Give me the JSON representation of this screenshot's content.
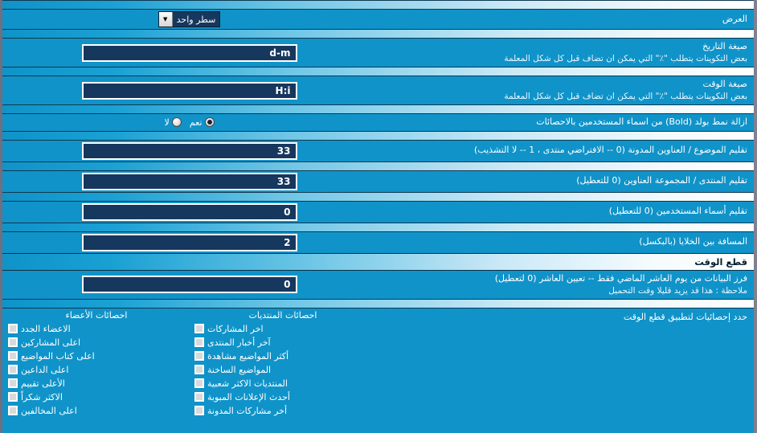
{
  "display_row": {
    "label": "العرض",
    "select_value": "سطر واحد",
    "options": [
      "سطر واحد"
    ]
  },
  "date_format_row": {
    "label": "صيغة التاريخ",
    "sub": "بعض التكوينات يتطلب \"٪\" التي يمكن ان تضاف قبل كل شكل المعلمة",
    "value": "d-m"
  },
  "time_format_row": {
    "label": "صيغة الوقت",
    "sub": "بعض التكوينات يتطلب \"٪\" التي يمكن ان تضاف قبل كل شكل المعلمة",
    "value": "H:i"
  },
  "bold_row": {
    "label": "ازالة نمط بولد (Bold) من اسماء المستخدمين بالاحصائات",
    "yes_label": "نعم",
    "no_label": "لا",
    "selected": "yes"
  },
  "topic_trim_row": {
    "label": "تقليم الموضوع / العناوين المدونة (0 -- الافتراضي منتدى ، 1 -- لا التشذيب)",
    "value": "33"
  },
  "forum_trim_row": {
    "label": "تقليم المنتدى / المجموعة العناوين (0 للتعطيل)",
    "value": "33"
  },
  "username_trim_row": {
    "label": "تقليم أسماء المستخدمين (0 للتعطيل)",
    "value": "0"
  },
  "cell_spacing_row": {
    "label": "المسافة بين الخلايا (بالبكسل)",
    "value": "2"
  },
  "cutoff_section": {
    "title": "قطع الوقت"
  },
  "cutoff_days_row": {
    "label": "فرز البيانات من يوم العاشر الماضي فقط -- تعيين العاشر (0 لتعطيل)",
    "sub": "ملاحظة : هذا قد يزيد قليلا وقت التحميل",
    "value": "0"
  },
  "cutoff_stats_row": {
    "label": "حدد إحصائيات لتطبيق قطع الوقت",
    "columns": [
      {
        "header": "احصائات المنتديات",
        "items": [
          {
            "label": "اخر المشاركات",
            "checked": false
          },
          {
            "label": "آخر أخبار المنتدى",
            "checked": false
          },
          {
            "label": "أكثر المواضيع مشاهدة",
            "checked": false
          },
          {
            "label": "المواضيع الساخنة",
            "checked": false
          },
          {
            "label": "المنتديات الاكثر شعبية",
            "checked": false
          },
          {
            "label": "أحدث الإعلانات المبوبة",
            "checked": false
          },
          {
            "label": "أخر مشاركات المدونة",
            "checked": false
          }
        ]
      },
      {
        "header": "احصائات الأعضاء",
        "items": [
          {
            "label": "الاعضاء الجدد",
            "checked": false
          },
          {
            "label": "اعلى المشاركين",
            "checked": false
          },
          {
            "label": "اعلى كتاب المواضيع",
            "checked": false
          },
          {
            "label": "اعلى الداعين",
            "checked": false
          },
          {
            "label": "الأعلى تقييم",
            "checked": false
          },
          {
            "label": "الاكثر شكراً",
            "checked": false
          },
          {
            "label": "اعلى المخالفين",
            "checked": false
          }
        ]
      }
    ]
  },
  "icons": {
    "chevron_down": "▼"
  }
}
